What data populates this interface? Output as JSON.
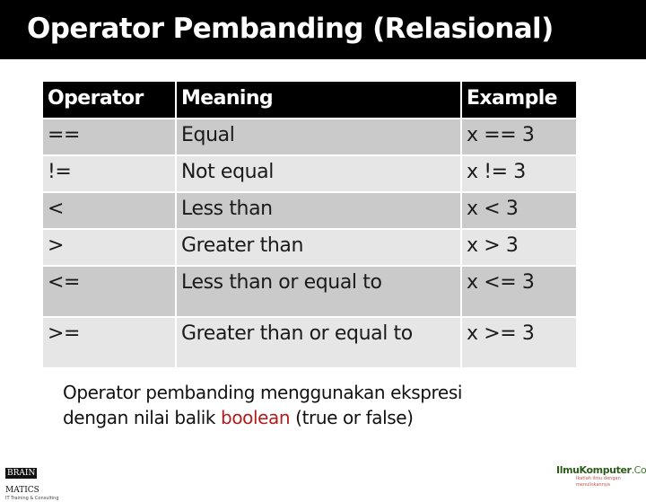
{
  "title": "Operator Pembanding (Relasional)",
  "table": {
    "headers": [
      "Operator",
      "Meaning",
      "Example"
    ],
    "rows": [
      {
        "operator": "==",
        "meaning": "Equal",
        "example": "x == 3"
      },
      {
        "operator": "!=",
        "meaning": "Not equal",
        "example": "x != 3"
      },
      {
        "operator": "<",
        "meaning": "Less than",
        "example": "x < 3"
      },
      {
        "operator": ">",
        "meaning": "Greater than",
        "example": "x > 3"
      },
      {
        "operator": "<=",
        "meaning": "Less than or equal to",
        "example": "x <= 3"
      },
      {
        "operator": ">=",
        "meaning": "Greater than or equal to",
        "example": "x >= 3"
      }
    ]
  },
  "caption": {
    "line1": "Operator pembanding menggunakan ekspresi",
    "line2_prefix": "dengan nilai balik ",
    "line2_highlight": "boolean",
    "line2_suffix": " (true or false)"
  },
  "colors": {
    "title_bg": "#000000",
    "header_bg": "#000000",
    "row_dark": "#cacaca",
    "row_light": "#e6e6e6",
    "highlight": "#b01c1c"
  },
  "footer": {
    "left_logo": {
      "boxed": "BRAIN",
      "rest": "MATICS",
      "subtitle": "IT Training & Consulting"
    },
    "right_logo": {
      "name": "IlmuKomputer",
      "suffix": ".Com",
      "tagline": "Ikatlah ilmu dengan menuliskannya"
    }
  }
}
